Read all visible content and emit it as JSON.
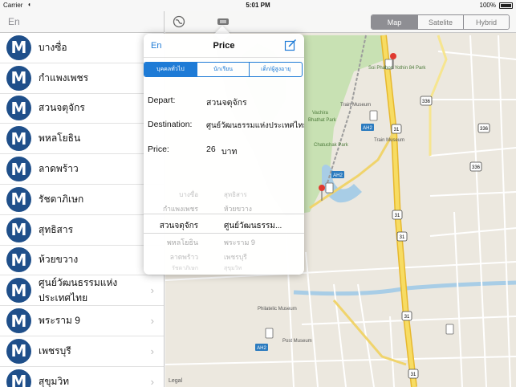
{
  "status_bar": {
    "carrier": "Carrier",
    "time": "5:01 PM",
    "battery": "100%"
  },
  "sidebar": {
    "lang": "En",
    "stations": [
      {
        "name": "บางซื่อ",
        "chevron": false
      },
      {
        "name": "กำแพงเพชร",
        "chevron": false
      },
      {
        "name": "สวนจตุจักร",
        "chevron": false
      },
      {
        "name": "พหลโยธิน",
        "chevron": false
      },
      {
        "name": "ลาดพร้าว",
        "chevron": false
      },
      {
        "name": "รัชดาภิเษก",
        "chevron": false
      },
      {
        "name": "สุทธิสาร",
        "chevron": false
      },
      {
        "name": "ห้วยขวาง",
        "chevron": false
      },
      {
        "name": "ศูนย์วัฒนธรรมแห่งประเทศไทย",
        "chevron": true
      },
      {
        "name": "พระราม 9",
        "chevron": true
      },
      {
        "name": "เพชรบุรี",
        "chevron": true
      },
      {
        "name": "สุขุมวิท",
        "chevron": true
      }
    ],
    "badge_letter": "M"
  },
  "map": {
    "view_modes": [
      "Map",
      "Satelite",
      "Hybrid"
    ],
    "active_view": "Map",
    "legal": "Legal",
    "labels": {
      "train_museum_1": "Train Museum",
      "train_museum_2": "Train Museum",
      "chatuchak_park": "Chatuchak Park",
      "vachira": "Vachira",
      "benchasiri": "Bhathat Park",
      "philatelic": "Philatelic Museum",
      "post_museum": "Post Museum",
      "ah2_a": "AH2",
      "ah2_b": "AH2",
      "ah2_c": "AH2",
      "route_31_a": "31",
      "route_31_b": "31",
      "route_31_c": "31",
      "route_31_d": "31",
      "route_31_e": "31",
      "route_31_f": "31",
      "route_1": "1",
      "route_336_a": "336",
      "route_336_b": "336",
      "route_336_c": "336",
      "park_north": "Soi Phahon Yothin 84 Park",
      "soi_label": "Soi Phahon Yothin 84 Park"
    }
  },
  "popover": {
    "lang": "En",
    "title": "Price",
    "fare_types": [
      "บุคคลทั่วไป",
      "นักเรียน",
      "เด็ก/ผู้สูงอายุ"
    ],
    "active_fare": "บุคคลทั่วไป",
    "depart_label": "Depart:",
    "depart_value": "สวนจตุจักร",
    "destination_label": "Destination:",
    "destination_value": "ศูนย์วัฒนธรรมแห่งประเทศไทย",
    "price_label": "Price:",
    "price_value": "26",
    "price_unit": "บาท",
    "picker_left": [
      "บางซื่อ",
      "กำแพงเพชร",
      "สวนจตุจักร",
      "พหลโยธิน",
      "ลาดพร้าว",
      "รัชดาภิเษก"
    ],
    "picker_right": [
      "สุทธิสาร",
      "ห้วยขวาง",
      "ศูนย์วัฒนธรรม...",
      "พระราม 9",
      "เพชรบุรี",
      "สุขุมวิท"
    ]
  },
  "colors": {
    "accent": "#1e7bd6",
    "mrt_badge": "#1f4f8a",
    "highway": "#f2cc3f",
    "park": "#c7e0b0"
  }
}
